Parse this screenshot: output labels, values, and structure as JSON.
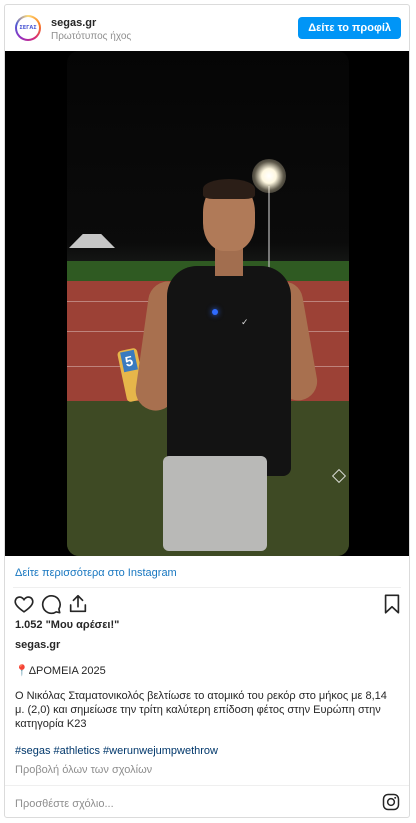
{
  "header": {
    "username": "segas.gr",
    "subtitle": "Πρωτότυπος ήχος",
    "avatar_text": "ΣΕΓΑΣ",
    "profile_button": "Δείτε το προφίλ"
  },
  "media": {
    "cone_label": "5",
    "swoosh": "✓"
  },
  "links": {
    "more_on_instagram": "Δείτε περισσότερα στο Instagram"
  },
  "actions": {
    "like_icon": "heart-icon",
    "comment_icon": "comment-icon",
    "share_icon": "share-icon",
    "save_icon": "bookmark-icon"
  },
  "likes": "1.052 \"Μου αρέσει!\"",
  "caption": {
    "username": "segas.gr",
    "line1": "📍ΔΡΟΜΕΙΑ 2025",
    "body": "Ο Νικόλας Σταματονικολός βελτίωσε το ατομικό του ρεκόρ στο μήκος με 8,14 μ. (2,0) και σημείωσε την τρίτη καλύτερη επίδοση φέτος στην Ευρώπη στην κατηγορία Κ23",
    "hashtags": "#segas #athletics #werunwejumpwethrow"
  },
  "comments": {
    "view_all": "Προβολή όλων των σχολίων",
    "placeholder": "Προσθέστε σχόλιο..."
  },
  "colors": {
    "accent": "#0095f6",
    "link": "#1877c0",
    "hashtag": "#00376b"
  }
}
